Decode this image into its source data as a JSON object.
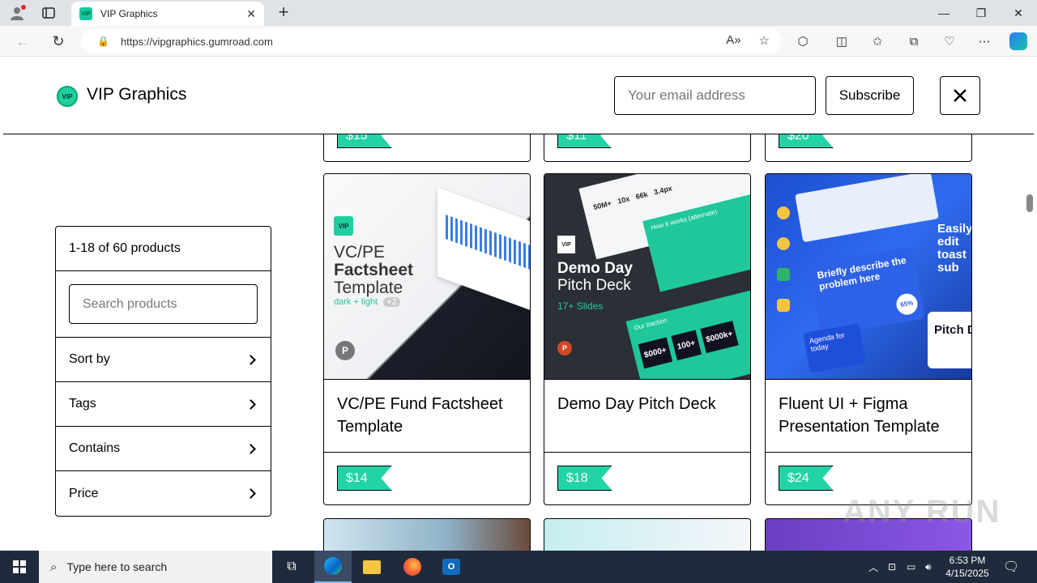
{
  "browser": {
    "tab_title": "VIP Graphics",
    "url": "https://vipgraphics.gumroad.com",
    "tab_favicon_text": "VIP"
  },
  "header": {
    "brand": "VIP Graphics",
    "logo_text": "VIP",
    "email_placeholder": "Your email address",
    "subscribe_label": "Subscribe"
  },
  "filters": {
    "count": "1-18 of 60 products",
    "search_placeholder": "Search products",
    "rows": [
      "Sort by",
      "Tags",
      "Contains",
      "Price"
    ]
  },
  "products": [
    {
      "name": "VC/PE Fund Factsheet Template",
      "price": "$14",
      "thumb": {
        "logo": "VIP",
        "line1": "VC/PE",
        "line2": "Factsheet",
        "line3": "Template",
        "sub": "dark + light",
        "badge": "+2"
      }
    },
    {
      "name": "Demo Day Pitch Deck",
      "price": "$18",
      "thumb": {
        "logo": "VIP",
        "line1": "Demo Day",
        "line2": "Pitch Deck",
        "sub": "17+ Slides",
        "stats": [
          "$000+",
          "100+",
          "$000k+"
        ],
        "caption": "Our traction",
        "top_stats": [
          "50M+",
          "3.4px",
          "10x",
          "66k"
        ],
        "how": "How it works (alternate)"
      }
    },
    {
      "name": "Fluent UI + Figma Presentation Template",
      "price": "$24",
      "thumb": {
        "text1": "Briefly describe the problem here",
        "text2": "Easily edit toast sub",
        "text3": "Agenda for today",
        "pct": "65%",
        "pitch": "Pitch D"
      }
    }
  ],
  "top_row_prices": [
    "$15",
    "$11",
    "$20"
  ],
  "taskbar": {
    "search_placeholder": "Type here to search",
    "time": "6:53 PM",
    "date": "4/15/2025"
  },
  "watermark": "ANY RUN",
  "colors": {
    "price_tag": "#22d3a5",
    "brand_logo": "#1fcf9f",
    "taskbar": "#1f2b3c"
  }
}
